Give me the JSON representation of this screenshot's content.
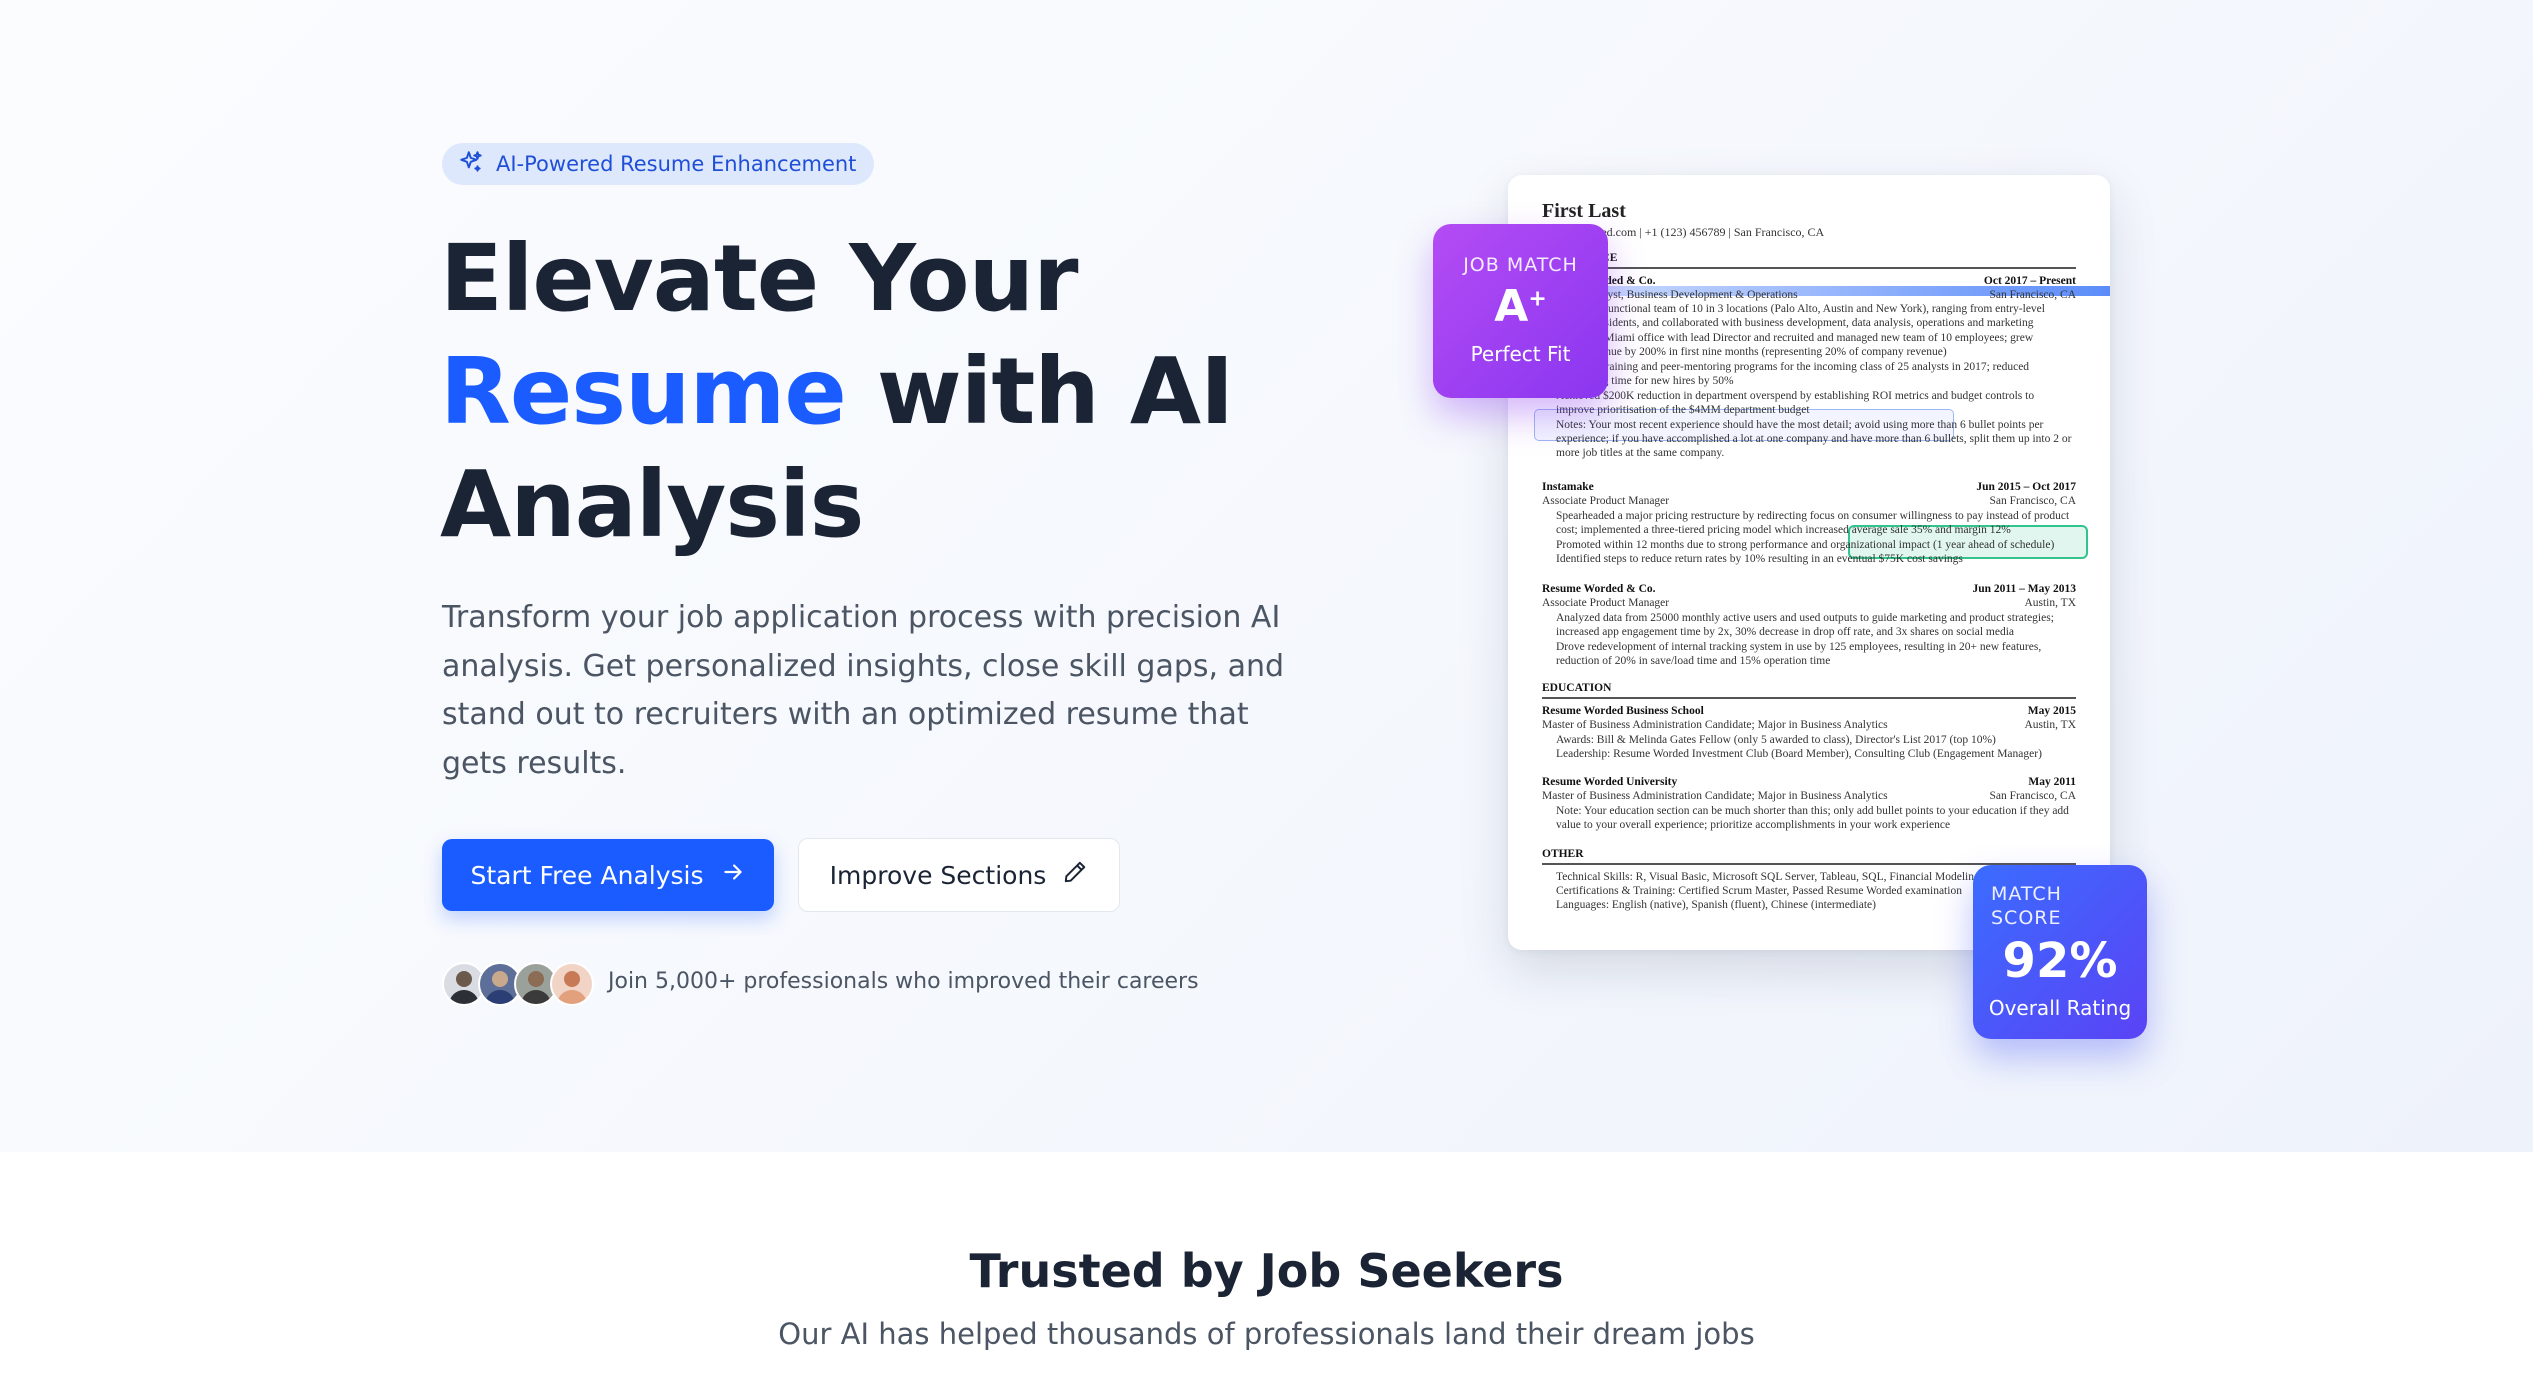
{
  "hero": {
    "badge_label": "AI-Powered Resume Enhancement",
    "headline_line1": "Elevate Your",
    "headline_highlight": "Resume",
    "headline_line2_rest": " with AI",
    "headline_line3": "Analysis",
    "subtext": "Transform your job application process with precision AI analysis. Get personalized insights, close skill gaps, and stand out to recruiters with an optimized resume that gets results.",
    "primary_button": "Start Free Analysis",
    "secondary_button": "Improve Sections",
    "social_proof": "Join 5,000+ professionals who improved their careers",
    "colors": {
      "accent": "#1a5cff",
      "badge_bg": "#dde8fd",
      "text_dark": "#1b2434"
    }
  },
  "resume_preview": {
    "name": "First Last",
    "contact": "resumeworded.com | +1 (123) 456789 | San Francisco, CA",
    "section_experience": "EXPERIENCE",
    "job1_company": "Resume Worded & Co.",
    "job1_dates": "Oct 2017 – Present",
    "job1_title": "Business Analyst, Business Development & Operations",
    "job1_location": "San Francisco, CA",
    "job1_b1a": "Led cross-functional team of 10 in 3 locations (Palo Alto, Austin and New York), ranging from entry-level",
    "job1_b1b": "to vice presidents, and collaborated with business development, data analysis, operations and marketing",
    "job1_b2a": "Launched Miami office with lead Director and recruited and managed new team of 10 employees; grew",
    "job1_b2b": "office revenue by 200% in first nine months (representing 20% of company revenue)",
    "job1_b3a": "Designed training and peer-mentoring programs for the incoming class of 25 analysts in 2017; reduced",
    "job1_b3b": "onboarding time for new hires by 50%",
    "job1_b4a": "Achieved $200K reduction in department overspend by establishing ROI metrics and budget controls to",
    "job1_b4b": "improve prioritisation of the $4MM department budget",
    "job1_b5a": "Notes: Your most recent experience should have the most detail; avoid using more than 6 bullet points per",
    "job1_b5b": "experience; if you have accomplished a lot at one company and have more than 6 bullets, split them up into 2 or",
    "job1_b5c": "more job titles at the same company.",
    "job2_company": "Instamake",
    "job2_dates": "Jun 2015 – Oct 2017",
    "job2_title": "Associate Product Manager",
    "job2_location": "San Francisco, CA",
    "job2_b1a": "Spearheaded a major pricing restructure by redirecting focus on consumer willingness to pay instead of product",
    "job2_b1b": "cost; implemented a three-tiered pricing model which increased average sale 35% and margin 12%",
    "job2_b2": "Promoted within 12 months due to strong performance and organizational impact (1 year ahead of schedule)",
    "job2_b3": "Identified steps to reduce return rates by 10% resulting in an eventual $75K cost savings",
    "job3_company": "Resume Worded & Co.",
    "job3_dates": "Jun 2011 – May 2013",
    "job3_title": "Associate Product Manager",
    "job3_location": "Austin, TX",
    "job3_b1a": "Analyzed data from 25000 monthly active users and used outputs to guide marketing and product strategies;",
    "job3_b1b": "increased app engagement time by 2x, 30% decrease in drop off rate, and 3x shares on social media",
    "job3_b2a": "Drove redevelopment of internal tracking system in use by 125 employees, resulting in 20+ new features,",
    "job3_b2b": "reduction of 20% in save/load time and 15% operation time",
    "section_education": "EDUCATION",
    "edu1_school": "Resume Worded Business School",
    "edu1_date": "May 2015",
    "edu1_degree": "Master of Business Administration Candidate; Major in Business Analytics",
    "edu1_location": "Austin, TX",
    "edu1_b1": "Awards: Bill & Melinda Gates Fellow (only 5 awarded to class), Director's List 2017 (top 10%)",
    "edu1_b2": "Leadership: Resume Worded Investment Club (Board Member), Consulting Club (Engagement Manager)",
    "edu2_school": "Resume Worded University",
    "edu2_date": "May 2011",
    "edu2_degree": "Master of Business Administration Candidate; Major in Business Analytics",
    "edu2_location": "San Francisco, CA",
    "edu2_b1a": "Note: Your education section can be much shorter than this; only add bullet points to your education if they add",
    "edu2_b1b": "value to your overall experience; prioritize accomplishments in your work experience",
    "section_other": "OTHER",
    "other_b1": "Technical Skills: R, Visual Basic, Microsoft SQL Server, Tableau, SQL, Financial Modeling",
    "other_b2": "Certifications & Training: Certified Scrum Master, Passed Resume Worded examination",
    "other_b3": "Languages: English (native), Spanish (fluent), Chinese (intermediate)"
  },
  "job_match_card": {
    "label": "JOB MATCH",
    "grade": "A",
    "grade_suffix": "+",
    "caption": "Perfect Fit"
  },
  "match_score_card": {
    "label": "MATCH SCORE",
    "value": "92%",
    "caption": "Overall Rating"
  },
  "trusted": {
    "title": "Trusted by Job Seekers",
    "subtitle": "Our AI has helped thousands of professionals land their dream jobs"
  },
  "icons": [
    "sparkles-icon",
    "arrow-right-icon",
    "pencil-icon"
  ]
}
